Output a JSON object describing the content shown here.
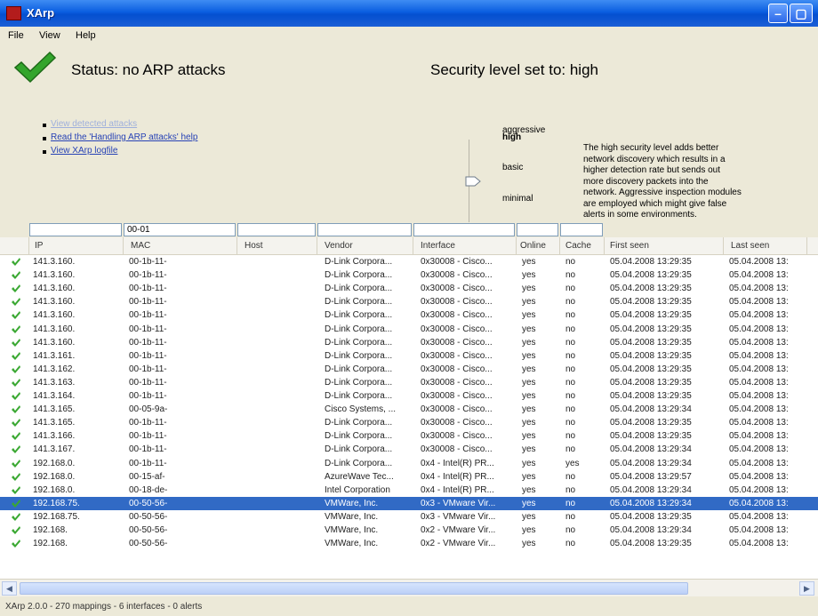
{
  "window": {
    "title": "XArp"
  },
  "menu": [
    "File",
    "View",
    "Help"
  ],
  "status": {
    "text": "Status: no ARP attacks"
  },
  "security": {
    "title": "Security level set to: high",
    "levels": [
      "aggressive",
      "high",
      "basic",
      "minimal"
    ],
    "description": "The high security level adds better network discovery which results in a higher detection rate but sends out more discovery packets into the network. Aggressive inspection modules are employed which might give false alerts in some environments."
  },
  "links": [
    "View detected attacks",
    "Read the 'Handling ARP attacks' help",
    "View XArp logfile"
  ],
  "filters": [
    "",
    "00-01",
    "",
    "",
    "",
    "",
    ""
  ],
  "columns": [
    "IP",
    "MAC",
    "Host",
    "Vendor",
    "Interface",
    "Online",
    "Cache",
    "First seen",
    "Last seen"
  ],
  "rows": [
    [
      "141.3.160.",
      "00-1b-11-",
      "",
      "D-Link Corpora...",
      "0x30008 - Cisco...",
      "yes",
      "no",
      "05.04.2008 13:29:35",
      "05.04.2008 13:"
    ],
    [
      "141.3.160.",
      "00-1b-11-",
      "",
      "D-Link Corpora...",
      "0x30008 - Cisco...",
      "yes",
      "no",
      "05.04.2008 13:29:35",
      "05.04.2008 13:"
    ],
    [
      "141.3.160.",
      "00-1b-11-",
      "",
      "D-Link Corpora...",
      "0x30008 - Cisco...",
      "yes",
      "no",
      "05.04.2008 13:29:35",
      "05.04.2008 13:"
    ],
    [
      "141.3.160.",
      "00-1b-11-",
      "",
      "D-Link Corpora...",
      "0x30008 - Cisco...",
      "yes",
      "no",
      "05.04.2008 13:29:35",
      "05.04.2008 13:"
    ],
    [
      "141.3.160.",
      "00-1b-11-",
      "",
      "D-Link Corpora...",
      "0x30008 - Cisco...",
      "yes",
      "no",
      "05.04.2008 13:29:35",
      "05.04.2008 13:"
    ],
    [
      "141.3.160.",
      "00-1b-11-",
      "",
      "D-Link Corpora...",
      "0x30008 - Cisco...",
      "yes",
      "no",
      "05.04.2008 13:29:35",
      "05.04.2008 13:"
    ],
    [
      "141.3.160.",
      "00-1b-11-",
      "",
      "D-Link Corpora...",
      "0x30008 - Cisco...",
      "yes",
      "no",
      "05.04.2008 13:29:35",
      "05.04.2008 13:"
    ],
    [
      "141.3.161.",
      "00-1b-11-",
      "",
      "D-Link Corpora...",
      "0x30008 - Cisco...",
      "yes",
      "no",
      "05.04.2008 13:29:35",
      "05.04.2008 13:"
    ],
    [
      "141.3.162.",
      "00-1b-11-",
      "",
      "D-Link Corpora...",
      "0x30008 - Cisco...",
      "yes",
      "no",
      "05.04.2008 13:29:35",
      "05.04.2008 13:"
    ],
    [
      "141.3.163.",
      "00-1b-11-",
      "",
      "D-Link Corpora...",
      "0x30008 - Cisco...",
      "yes",
      "no",
      "05.04.2008 13:29:35",
      "05.04.2008 13:"
    ],
    [
      "141.3.164.",
      "00-1b-11-",
      "",
      "D-Link Corpora...",
      "0x30008 - Cisco...",
      "yes",
      "no",
      "05.04.2008 13:29:35",
      "05.04.2008 13:"
    ],
    [
      "141.3.165.",
      "00-05-9a-",
      "",
      "Cisco Systems, ...",
      "0x30008 - Cisco...",
      "yes",
      "no",
      "05.04.2008 13:29:34",
      "05.04.2008 13:"
    ],
    [
      "141.3.165.",
      "00-1b-11-",
      "",
      "D-Link Corpora...",
      "0x30008 - Cisco...",
      "yes",
      "no",
      "05.04.2008 13:29:35",
      "05.04.2008 13:"
    ],
    [
      "141.3.166.",
      "00-1b-11-",
      "",
      "D-Link Corpora...",
      "0x30008 - Cisco...",
      "yes",
      "no",
      "05.04.2008 13:29:35",
      "05.04.2008 13:"
    ],
    [
      "141.3.167.",
      "00-1b-11-",
      "",
      "D-Link Corpora...",
      "0x30008 - Cisco...",
      "yes",
      "no",
      "05.04.2008 13:29:34",
      "05.04.2008 13:"
    ],
    [
      "192.168.0.",
      "00-1b-11-",
      "",
      "D-Link Corpora...",
      "0x4 - Intel(R) PR...",
      "yes",
      "yes",
      "05.04.2008 13:29:34",
      "05.04.2008 13:"
    ],
    [
      "192.168.0.",
      "00-15-af-",
      "",
      "AzureWave Tec...",
      "0x4 - Intel(R) PR...",
      "yes",
      "no",
      "05.04.2008 13:29:57",
      "05.04.2008 13:"
    ],
    [
      "192.168.0.",
      "00-18-de-",
      "",
      "Intel Corporation",
      "0x4 - Intel(R) PR...",
      "yes",
      "no",
      "05.04.2008 13:29:34",
      "05.04.2008 13:"
    ],
    [
      "192.168.75.",
      "00-50-56-",
      "",
      "VMWare, Inc.",
      "0x3 - VMware Vir...",
      "yes",
      "no",
      "05.04.2008 13:29:34",
      "05.04.2008 13:"
    ],
    [
      "192.168.75.",
      "00-50-56-",
      "",
      "VMWare, Inc.",
      "0x3 - VMware Vir...",
      "yes",
      "no",
      "05.04.2008 13:29:35",
      "05.04.2008 13:"
    ],
    [
      "192.168.",
      "00-50-56-",
      "",
      "VMWare, Inc.",
      "0x2 - VMware Vir...",
      "yes",
      "no",
      "05.04.2008 13:29:34",
      "05.04.2008 13:"
    ],
    [
      "192.168.",
      "00-50-56-",
      "",
      "VMWare, Inc.",
      "0x2 - VMware Vir...",
      "yes",
      "no",
      "05.04.2008 13:29:35",
      "05.04.2008 13:"
    ]
  ],
  "selected_row": 18,
  "statusbar": {
    "text": "XArp 2.0.0 - 270 mappings - 6 interfaces - 0 alerts"
  }
}
